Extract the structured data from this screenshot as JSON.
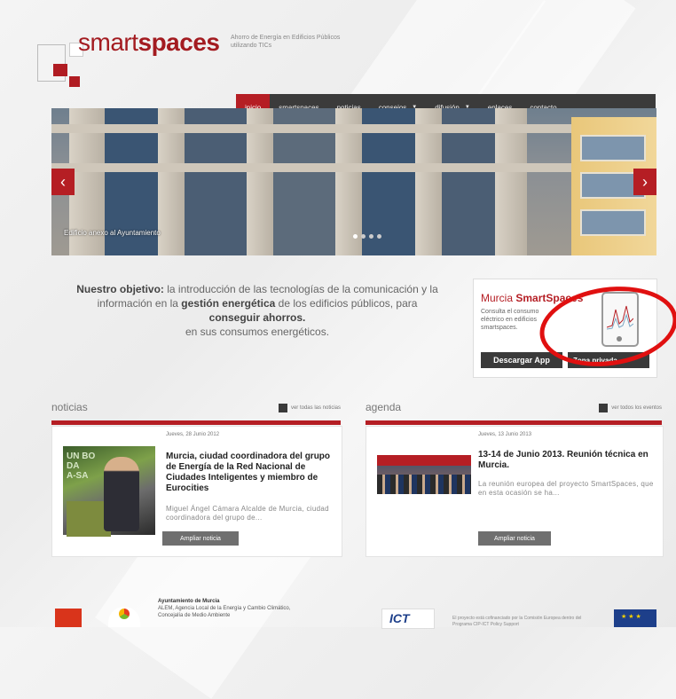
{
  "header": {
    "brand_light": "smart",
    "brand_bold": "spaces",
    "tagline": "Ahorro de Energía en Edificios Públicos utilizando TICs"
  },
  "nav": {
    "items": [
      {
        "label": "inicio"
      },
      {
        "label": "smartspaces"
      },
      {
        "label": "noticias"
      },
      {
        "label": "consejos"
      },
      {
        "label": "difusión"
      },
      {
        "label": "enlaces"
      },
      {
        "label": "contacto"
      }
    ],
    "caret": "▼"
  },
  "slider": {
    "caption": "Edificio anexo al Ayuntamiento",
    "prev": "‹",
    "next": "›",
    "slide_count": 4,
    "active_slide": 1
  },
  "objective": {
    "label": "Nuestro objetivo:",
    "t1": "la introducción de las tecnologías de la comunicación y la información en la",
    "b1": "gestión energética",
    "t2": "de los edificios públicos, para",
    "b2": "conseguir ahorros.",
    "t3": "en sus consumos energéticos."
  },
  "appbox": {
    "title_light": "Murcia",
    "title_bold": "SmartSpaces",
    "desc": "Consulta el consumo eléctrico en edificios smartspaces.",
    "download": "Descargar App",
    "private": "Zona privada."
  },
  "news": {
    "heading": "noticias",
    "more": "ver todas las noticias",
    "date": "Jueves, 28 Junio 2012",
    "title": "Murcia, ciudad coordinadora del grupo de Energía de la Red Nacional de Ciudades Inteligentes y miembro de Eurocities",
    "excerpt": "Miguel Ángel Cámara Alcalde de Murcia, ciudad coordinadora del grupo de...",
    "button": "Ampliar noticia",
    "photo_text": "UN BO\nDA\nA-SA"
  },
  "agenda": {
    "heading": "agenda",
    "more": "ver todos los eventos",
    "date": "Jueves, 13 Junio 2013",
    "title": "13-14 de Junio 2013. Reunión técnica en Murcia.",
    "excerpt": "La reunión europea del proyecto SmartSpaces, que en esta ocasión se ha...",
    "button": "Ampliar noticia"
  },
  "footer": {
    "org": "Ayuntamiento de Murcia",
    "org_detail": "ALEM, Agencia Local de la Energía y Cambio Climático, Concejalía de Medio Ambiente",
    "eu_text": "El proyecto está cofinanciado por la Comisión Europea dentro del Programa CIP-ICT Policy Support"
  },
  "colors": {
    "brand_red": "#b51e24",
    "nav_dark": "#3b3b3b",
    "annotation_red": "#e01010"
  }
}
